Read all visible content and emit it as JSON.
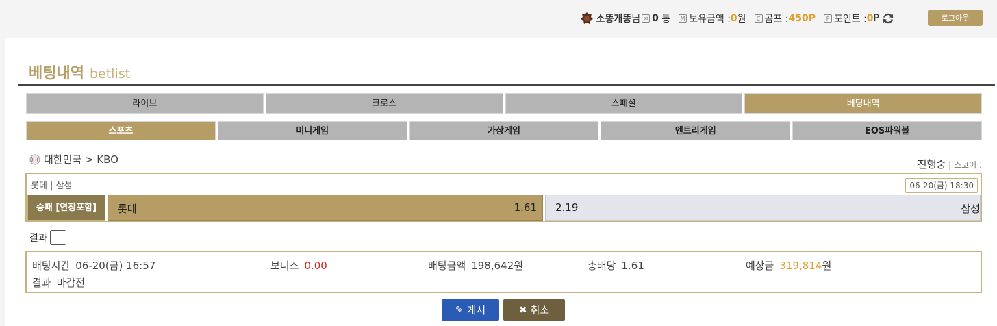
{
  "header": {
    "username": "소똥개똥",
    "username_suffix": "님",
    "messages_count": "0",
    "messages_unit": "통",
    "balance_label": "보유금액 : ",
    "balance_value": "0",
    "balance_unit": "원",
    "comp_label": "콤프 : ",
    "comp_value": "450",
    "comp_unit": "P",
    "point_label": "포인트 : ",
    "point_value": "0",
    "point_unit": "P",
    "logout_label": "로그아웃"
  },
  "page": {
    "title": "베팅내역",
    "subtitle": "betlist"
  },
  "tabs_main": [
    {
      "label": "라이브",
      "active": false
    },
    {
      "label": "크로스",
      "active": false
    },
    {
      "label": "스페셜",
      "active": false
    },
    {
      "label": "베팅내역",
      "active": true
    }
  ],
  "tabs_sub": [
    {
      "label": "스포츠",
      "active": true
    },
    {
      "label": "미니게임",
      "active": false
    },
    {
      "label": "가상게임",
      "active": false
    },
    {
      "label": "엔트리게임",
      "active": false
    },
    {
      "label": "EOS파워볼",
      "active": false
    }
  ],
  "league": {
    "path": "대한민국 > KBO"
  },
  "status": {
    "state": "진행중",
    "score_label": "| 스코어 :"
  },
  "match": {
    "teams": "롯데 | 삼성",
    "datetime": "06-20(금) 18:30",
    "market": "승패 [연장포함]",
    "home_team": "롯데",
    "home_odds": "1.61",
    "away_odds": "2.19",
    "away_team": "삼성"
  },
  "result": {
    "label": "결과"
  },
  "bet": {
    "time_label": "배팅시간",
    "time_value": "06-20(금) 16:57",
    "bonus_label": "보너스",
    "bonus_value": "0.00",
    "amount_label": "배팅금액",
    "amount_value": "198,642원",
    "total_odds_label": "총배당",
    "total_odds_value": "1.61",
    "expected_label": "예상금",
    "expected_value": "319,814",
    "expected_unit": "원",
    "result_label": "결과",
    "result_value": "마감전"
  },
  "buttons": {
    "post": "게시",
    "cancel": "취소"
  }
}
